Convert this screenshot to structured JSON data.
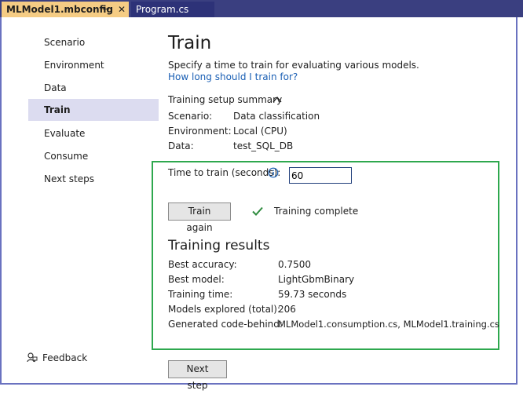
{
  "tabs": [
    {
      "label": "MLModel1.mbconfig",
      "pin": "⊸",
      "close": "✕"
    },
    {
      "label": "Program.cs"
    }
  ],
  "sidebar": {
    "items": [
      {
        "label": "Scenario"
      },
      {
        "label": "Environment"
      },
      {
        "label": "Data"
      },
      {
        "label": "Train"
      },
      {
        "label": "Evaluate"
      },
      {
        "label": "Consume"
      },
      {
        "label": "Next steps"
      }
    ],
    "feedback_label": "Feedback"
  },
  "main": {
    "title": "Train",
    "subtitle": "Specify a time to train for evaluating various models.",
    "help_link": "How long should I train for?",
    "summary": {
      "heading": "Training setup summary",
      "rows": [
        {
          "key": "Scenario:",
          "value": "Data classification"
        },
        {
          "key": "Environment:",
          "value": "Local (CPU)"
        },
        {
          "key": "Data:",
          "value": "test_SQL_DB"
        }
      ]
    },
    "time_label": "Time to train (seconds):",
    "time_value": "60",
    "train_again_label": "Train again",
    "status_text": "Training complete",
    "results": {
      "heading": "Training results",
      "rows": [
        {
          "key": "Best accuracy:",
          "value": "0.7500"
        },
        {
          "key": "Best model:",
          "value": "LightGbmBinary"
        },
        {
          "key": "Training time:",
          "value": "59.73 seconds"
        },
        {
          "key": "Models explored (total):",
          "value": "206"
        },
        {
          "key": "Generated code-behind:",
          "value": "MLModel1.consumption.cs, MLModel1.training.cs"
        }
      ]
    },
    "next_step_label": "Next step"
  },
  "colors": {
    "tab_active": "#f5cc84",
    "tab_strip": "#3a3f80",
    "nav_selected": "#dcdcf0",
    "highlight_box": "#2ea84e",
    "link": "#1a5fb4",
    "check": "#2e8b3e"
  }
}
